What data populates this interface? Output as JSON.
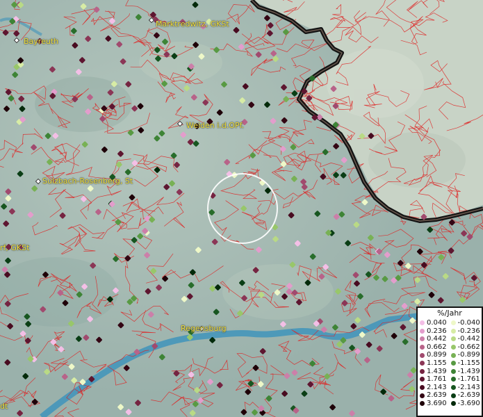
{
  "cities": [
    {
      "name": "Marktredwitz, GKSt",
      "marker": "city-marker-marktredwitz"
    },
    {
      "name": "Bayreuth",
      "marker": "city-marker-bayreuth"
    },
    {
      "name": "Weiden i.d.OPf.",
      "marker": "city-marker-weiden"
    },
    {
      "name": "Sulzbach-Rosenberg, St",
      "marker": "city-marker-sulzbach"
    },
    {
      "name": "Regensburg",
      "marker": "city-marker-regensburg"
    },
    {
      "name": "rf, GKSt",
      "marker": "city-marker-left"
    },
    {
      "name": "dt",
      "marker": "city-marker-bottom-left"
    }
  ],
  "legend": {
    "title": "%/Jahr",
    "positive": [
      "0.040",
      "0.236",
      "0.442",
      "0.662",
      "0.899",
      "1.155",
      "1.439",
      "1.761",
      "2.143",
      "2.639",
      "3.690"
    ],
    "negative": [
      "-0.040",
      "-0.236",
      "-0.442",
      "-0.662",
      "-0.899",
      "-1.155",
      "-1.439",
      "-1.761",
      "-2.143",
      "-2.639",
      "-3.690"
    ],
    "positive_colors": [
      "#f3bfe6",
      "#e39dcc",
      "#cc7fa9",
      "#b86389",
      "#a14a6e",
      "#8b3656",
      "#752441",
      "#5e1630",
      "#480b20",
      "#330513",
      "#1e0008"
    ],
    "negative_colors": [
      "#eef8c8",
      "#d7eca5",
      "#b9da85",
      "#98c76a",
      "#78b155",
      "#589a43",
      "#3e8436",
      "#286d2b",
      "#175620",
      "#0a3e15",
      "#032a0a"
    ]
  },
  "colors": {
    "land": "#9fb7b1",
    "border": "#141414",
    "river": "#3f94bb",
    "district_lines": "#e02020",
    "city_label": "#f1e23f",
    "selection_circle": "#ffffff"
  }
}
